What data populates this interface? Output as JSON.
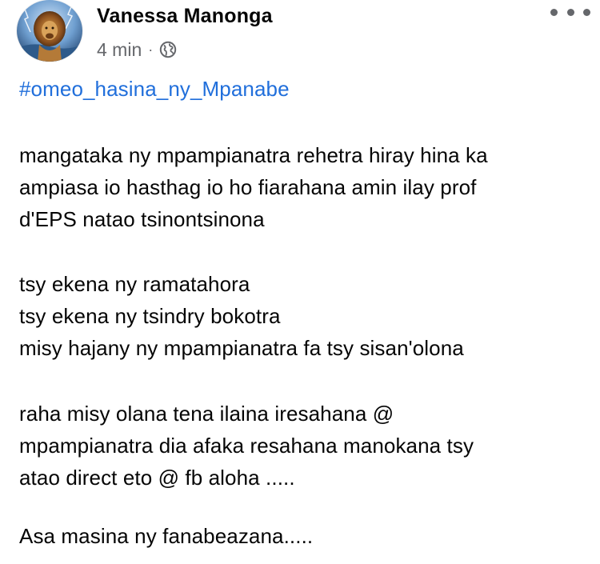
{
  "post": {
    "author": "Vanessa Manonga",
    "timestamp": "4 min",
    "separator": "·",
    "audience_icon": "globe-icon",
    "more_icon": "more-options-icon",
    "hashtag": "#omeo_hasina_ny_Mpanabe",
    "paragraphs": [
      [
        "mangataka ny mpampianatra rehetra hiray hina ka",
        "ampiasa io hasthag io ho fiarahana amin ilay prof",
        "d'EPS natao tsinontsinona"
      ],
      [
        "tsy ekena ny ramatahora",
        "tsy ekena ny tsindry bokotra",
        "misy hajany ny mpampianatra fa tsy sisan'olona"
      ],
      [
        "raha misy olana tena ilaina iresahana @",
        "mpampianatra dia afaka resahana manokana tsy",
        "atao direct eto @ fb aloha ....."
      ],
      [
        "Asa masina ny fanabeazana....."
      ]
    ],
    "colors": {
      "hashtag": "#216fdb",
      "secondary_text": "#65676b",
      "primary_text": "#050505"
    }
  }
}
